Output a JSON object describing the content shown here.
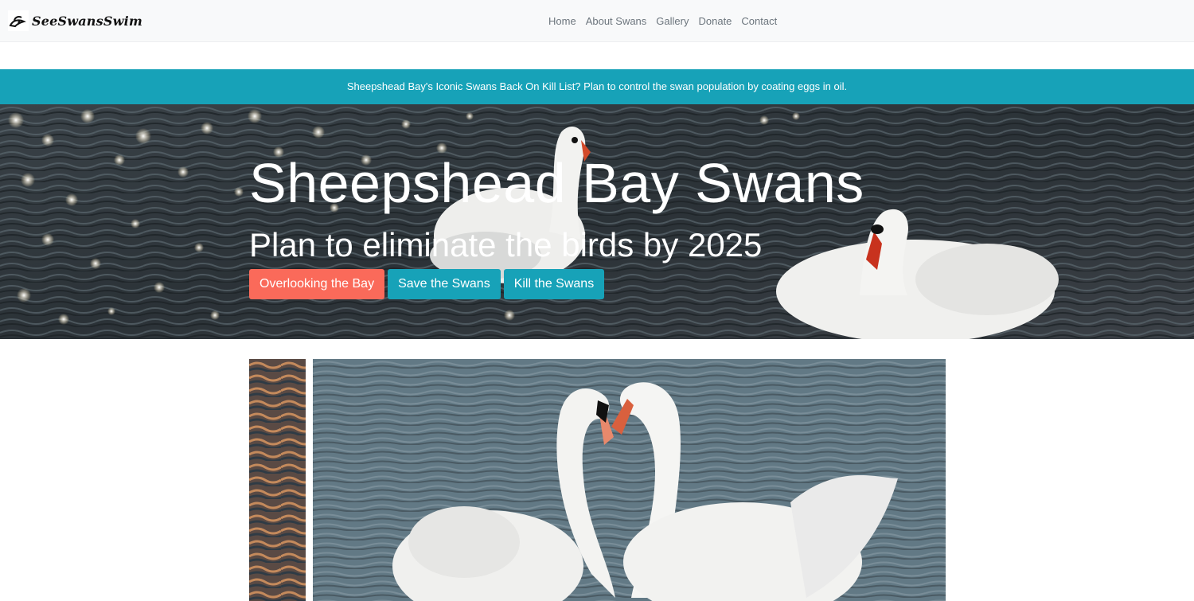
{
  "navbar": {
    "brand": "SeeSwansSwim",
    "brand_icon": "swan-logo-icon",
    "links": [
      "Home",
      "About Swans",
      "Gallery",
      "Donate",
      "Contact"
    ]
  },
  "alert": {
    "text": "Sheepshead Bay's Iconic Swans Back On Kill List? Plan to control the swan population by coating eggs in oil."
  },
  "hero": {
    "title": "Sheepshead Bay Swans",
    "subtitle": "Plan to eliminate the birds by 2025",
    "buttons": [
      "Overlooking the Bay",
      "Save the Swans",
      "Kill the Swans"
    ]
  },
  "colors": {
    "alert_bg": "#17a2b8",
    "coral_button": "#fa6a5a",
    "teal_button": "#17a2b8",
    "navbar_bg": "#f8f9fa"
  }
}
